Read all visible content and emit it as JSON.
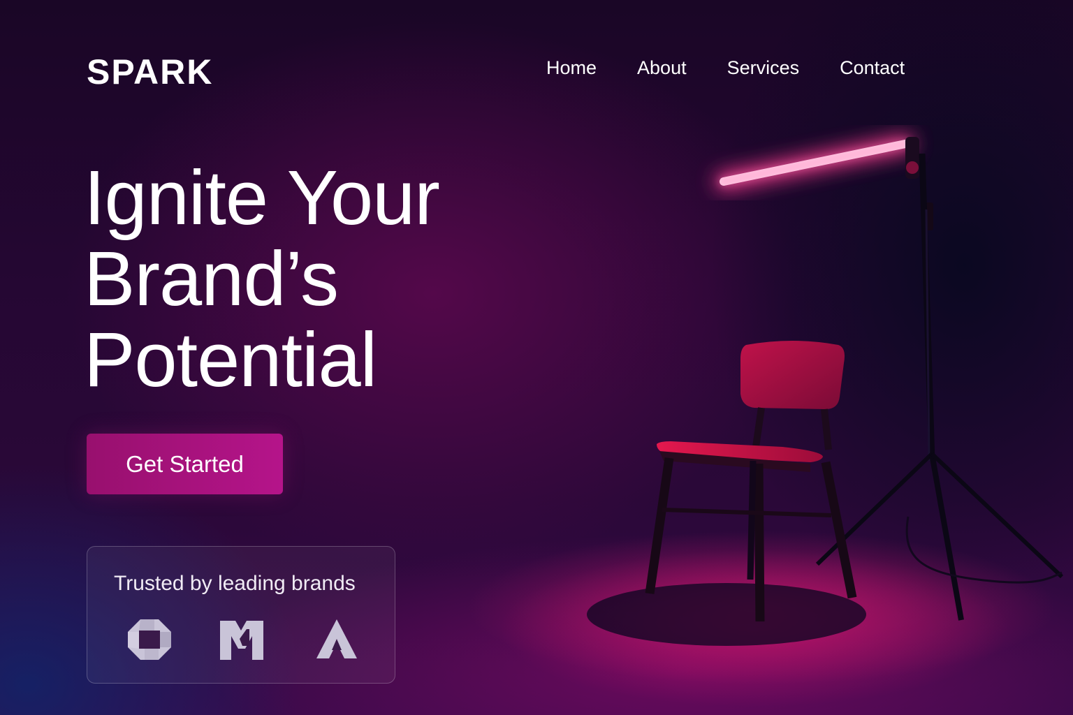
{
  "header": {
    "logo": "SPARK",
    "nav": [
      {
        "label": "Home"
      },
      {
        "label": "About"
      },
      {
        "label": "Services"
      },
      {
        "label": "Contact"
      }
    ]
  },
  "hero": {
    "headline_lines": [
      "Ignite Your",
      "Brand’s",
      "Potential"
    ],
    "cta_label": "Get Started"
  },
  "trusted": {
    "title": "Trusted by leading brands",
    "logos": [
      "octagon-brand-logo-icon",
      "m-brand-logo-icon",
      "a-triangle-brand-logo-icon"
    ]
  },
  "colors": {
    "accent": "#b5148a",
    "neon": "#ff5aa8",
    "background": "#250733"
  }
}
